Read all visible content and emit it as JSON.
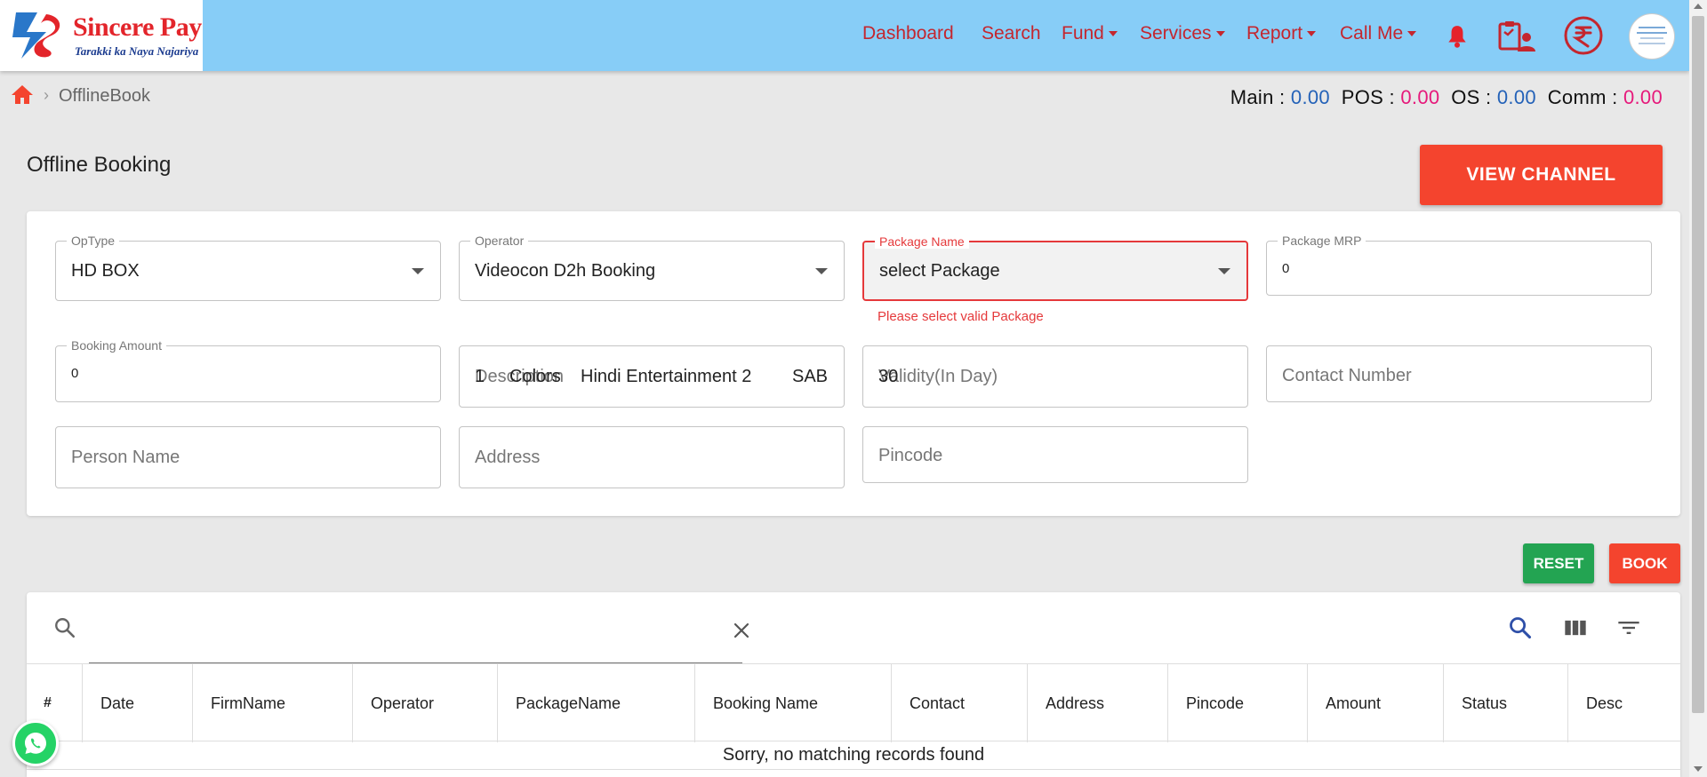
{
  "brand": {
    "name": "Sincere Pay",
    "tagline": "Tarakki ka Naya Najariya"
  },
  "nav": {
    "dashboard": "Dashboard",
    "search": "Search",
    "fund": "Fund",
    "services": "Services",
    "report": "Report",
    "call_me": "Call Me",
    "icons": [
      "bell-icon",
      "clipboard-user-icon",
      "rupee-icon",
      "profile-avatar"
    ]
  },
  "breadcrumb": {
    "page": "OfflineBook"
  },
  "balances": {
    "main_label": "Main :",
    "main_value": "0.00",
    "pos_label": "POS :",
    "pos_value": "0.00",
    "os_label": "OS :",
    "os_value": "0.00",
    "comm_label": "Comm :",
    "comm_value": "0.00"
  },
  "page": {
    "title": "Offline Booking",
    "view_channel": "VIEW CHANNEL"
  },
  "form": {
    "optype": {
      "label": "OpType",
      "value": "HD BOX"
    },
    "operator": {
      "label": "Operator",
      "value": "Videocon D2h Booking"
    },
    "package_name": {
      "label": "Package Name",
      "value": "select Package",
      "error": "Please select valid Package"
    },
    "package_mrp": {
      "label": "Package MRP",
      "value": "0"
    },
    "booking_amount": {
      "label": "Booking Amount",
      "value": "0"
    },
    "description": {
      "placeholder": "Description",
      "overlay": [
        "1",
        "Colors",
        "Hindi Entertainment 2",
        "SAB"
      ]
    },
    "validity": {
      "placeholder": "Validity(In Day)",
      "overlay": "30"
    },
    "contact": {
      "placeholder": "Contact Number"
    },
    "person": {
      "placeholder": "Person Name"
    },
    "address": {
      "placeholder": "Address"
    },
    "pincode": {
      "placeholder": "Pincode"
    }
  },
  "actions": {
    "reset": "RESET",
    "book": "BOOK"
  },
  "table": {
    "search_value": "",
    "columns": [
      "#",
      "Date",
      "FirmName",
      "Operator",
      "PackageName",
      "Booking Name",
      "Contact",
      "Address",
      "Pincode",
      "Amount",
      "Status",
      "Desc"
    ],
    "empty_message": "Sorry, no matching records found"
  },
  "colors": {
    "header_bg": "#87cdf7",
    "nav_red": "#c4262e",
    "accent_orange": "#f4442e",
    "reset_green": "#23a452",
    "error_red": "#e5393b",
    "value_blue": "#2462b8",
    "value_pink": "#e6197b"
  }
}
